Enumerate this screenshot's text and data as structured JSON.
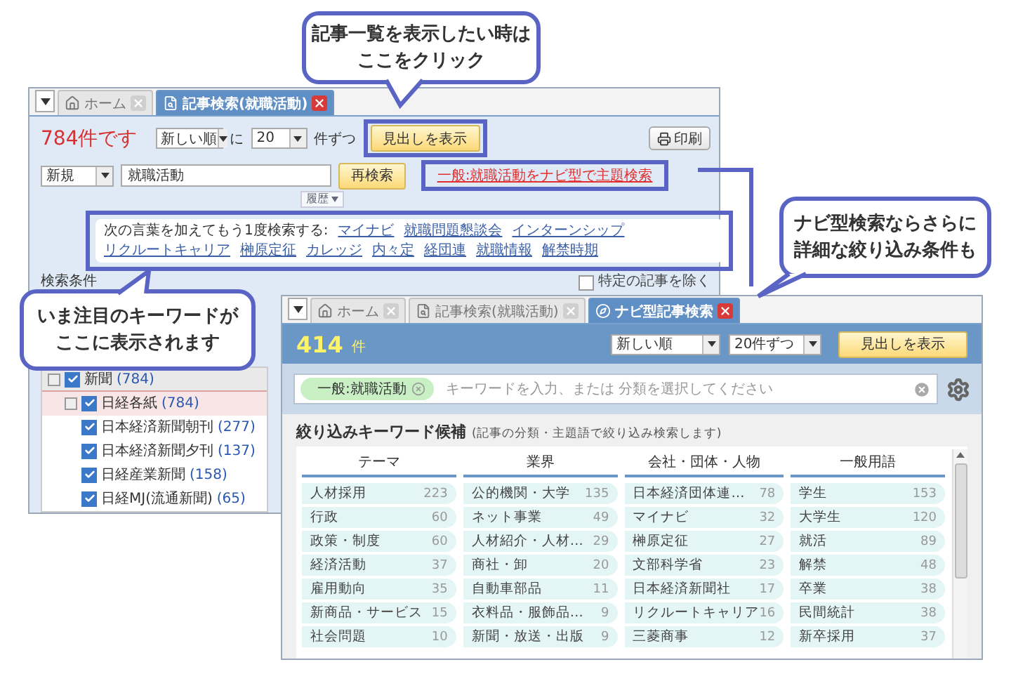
{
  "callouts": [
    {
      "kind": "top",
      "lines": [
        "記事一覧を表示したい時は",
        "ここをクリック"
      ]
    },
    {
      "kind": "right",
      "lines": [
        "ナビ型検索ならさらに",
        "詳細な絞り込み条件も"
      ]
    },
    {
      "kind": "left",
      "lines": [
        "いま注目のキーワードが",
        "ここに表示されます"
      ]
    }
  ],
  "back_window": {
    "tabs": [
      {
        "label": "ホーム",
        "selected": false
      },
      {
        "label": "記事検索(就職活動)",
        "selected": true
      }
    ],
    "count": "784件です",
    "sort": "新しい順",
    "per_label": "に",
    "per_page": "20",
    "per_suffix": "件ずつ",
    "show_button": "見出しを表示",
    "print_button": "印刷",
    "mode": "新規",
    "query": "就職活動",
    "history": "履歴",
    "research_button": "再検索",
    "navi_link": "一般:就職活動をナビ型で主題検索",
    "suggest_label": "次の言葉を加えてもう1度検索する:",
    "suggestions": [
      "マイナビ",
      "就職問題懇談会",
      "インターンシップ",
      "リクルートキャリア",
      "榊原定征",
      "カレッジ",
      "内々定",
      "経団連",
      "就職情報",
      "解禁時期"
    ],
    "conditions_label": "検索条件",
    "exclude": {
      "label": "特定の記事を除く",
      "checked": false
    },
    "tree": [
      {
        "label": "新聞",
        "count": "(784)",
        "checked": true,
        "selected": false,
        "children": [
          {
            "label": "日経各紙",
            "count": "(784)",
            "checked": true,
            "selected": true,
            "children": [
              {
                "label": "日本経済新聞朝刊",
                "count": "(277)",
                "checked": true,
                "selected": false
              },
              {
                "label": "日本経済新聞夕刊",
                "count": "(137)",
                "checked": true,
                "selected": false
              },
              {
                "label": "日経産業新聞",
                "count": "(158)",
                "checked": true,
                "selected": false
              },
              {
                "label": "日経MJ(流通新聞)",
                "count": "(65)",
                "checked": true,
                "selected": false
              }
            ]
          }
        ]
      }
    ]
  },
  "front_window": {
    "tabs": [
      {
        "label": "ホーム",
        "selected": false
      },
      {
        "label": "記事検索(就職活動)",
        "selected": false
      },
      {
        "label": "ナビ型記事検索",
        "selected": true
      }
    ],
    "count": "414",
    "count_unit": "件",
    "sort": "新しい順",
    "per_page": "20件ずつ",
    "show_button": "見出しを表示",
    "chip": "一般:就職活動",
    "placeholder": "キーワードを入力、または 分類を選択してください",
    "panel_title": "絞り込みキーワード候補",
    "panel_note": "(記事の分類・主題語で絞り込み検索します)",
    "columns": [
      {
        "title": "テーマ",
        "items": [
          {
            "name": "人材採用",
            "count": "223"
          },
          {
            "name": "行政",
            "count": "60"
          },
          {
            "name": "政策・制度",
            "count": "60"
          },
          {
            "name": "経済活動",
            "count": "37"
          },
          {
            "name": "雇用動向",
            "count": "35"
          },
          {
            "name": "新商品・サービス",
            "count": "15"
          },
          {
            "name": "社会問題",
            "count": "10"
          }
        ]
      },
      {
        "title": "業界",
        "items": [
          {
            "name": "公的機関・大学",
            "count": "135"
          },
          {
            "name": "ネット事業",
            "count": "49"
          },
          {
            "name": "人材紹介・人材…",
            "count": "29"
          },
          {
            "name": "商社・卸",
            "count": "20"
          },
          {
            "name": "自動車部品",
            "count": "11"
          },
          {
            "name": "衣料品・服飾品…",
            "count": "9"
          },
          {
            "name": "新聞・放送・出版",
            "count": "9"
          }
        ]
      },
      {
        "title": "会社・団体・人物",
        "items": [
          {
            "name": "日本経済団体連…",
            "count": "78"
          },
          {
            "name": "マイナビ",
            "count": "32"
          },
          {
            "name": "榊原定征",
            "count": "27"
          },
          {
            "name": "文部科学省",
            "count": "23"
          },
          {
            "name": "日本経済新聞社",
            "count": "17"
          },
          {
            "name": "リクルートキャリア",
            "count": "16"
          },
          {
            "name": "三菱商事",
            "count": "12"
          }
        ]
      },
      {
        "title": "一般用語",
        "items": [
          {
            "name": "学生",
            "count": "153"
          },
          {
            "name": "大学生",
            "count": "120"
          },
          {
            "name": "就活",
            "count": "89"
          },
          {
            "name": "解禁",
            "count": "48"
          },
          {
            "name": "卒業",
            "count": "38"
          },
          {
            "name": "民間統計",
            "count": "38"
          },
          {
            "name": "新卒採用",
            "count": "37"
          }
        ]
      }
    ]
  }
}
